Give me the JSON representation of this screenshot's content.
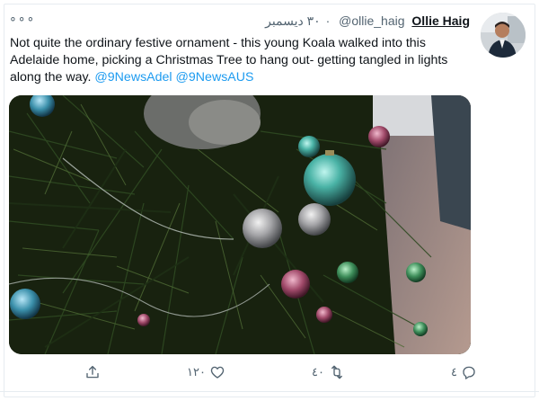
{
  "tweet": {
    "author_name": "Ollie Haig",
    "author_handle": "@ollie_haig",
    "date": "٣٠ ديسمبر",
    "separator": "·",
    "more_label": "∘∘∘",
    "text": "Not quite the ordinary festive ornament - this young Koala walked into this Adelaide home, picking a Christmas Tree to hang out- getting tangled in lights along the way.",
    "mentions": [
      "@9NewsAdel",
      "@9NewsAUS"
    ]
  },
  "actions": {
    "reply_count": "٤",
    "retweet_count": "٤٠",
    "like_count": "١٢٠",
    "share_count": ""
  },
  "icons": {
    "reply": "reply-icon",
    "retweet": "retweet-icon",
    "like": "heart-icon",
    "share": "share-icon",
    "more": "more-icon"
  },
  "colors": {
    "link": "#1d9bf0",
    "secondary_text": "#536471",
    "primary_text": "#0f1419"
  }
}
